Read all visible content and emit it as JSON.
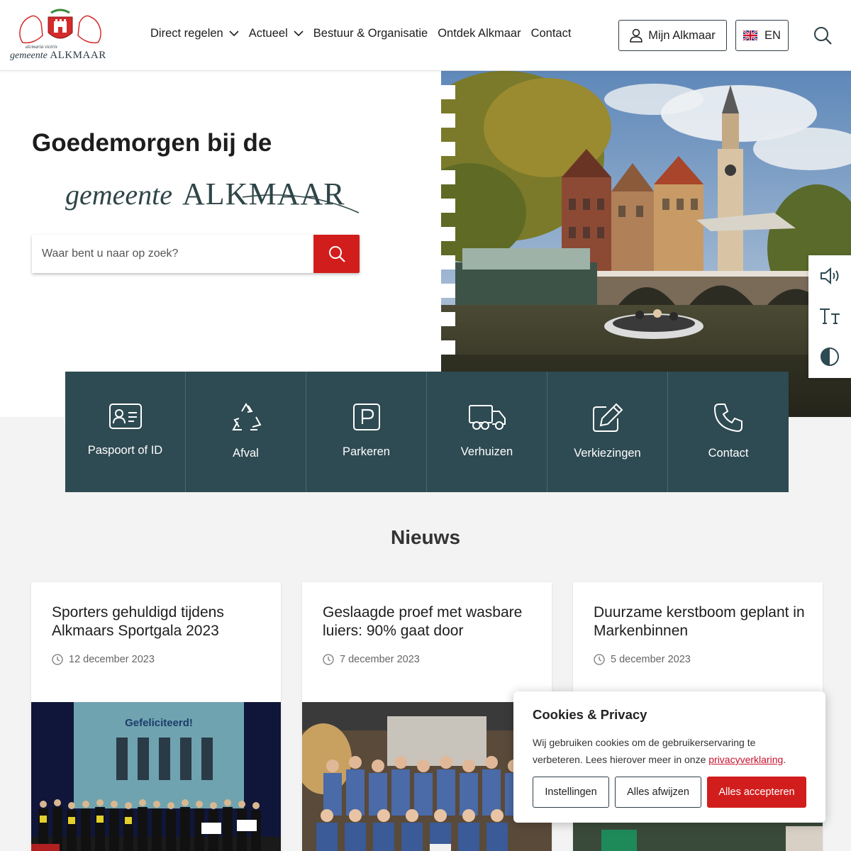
{
  "header": {
    "logo_motto": "alcmaria victrix",
    "logo_word_small": "gemeente",
    "logo_word_big": "ALKMAAR",
    "nav": [
      {
        "label": "Direct regelen",
        "dropdown": true
      },
      {
        "label": "Actueel",
        "dropdown": true
      },
      {
        "label": "Bestuur & Organisatie",
        "dropdown": false
      },
      {
        "label": "Ontdek Alkmaar",
        "dropdown": false
      },
      {
        "label": "Contact",
        "dropdown": false
      }
    ],
    "mijn_label": "Mijn Alkmaar",
    "lang_label": "EN",
    "icons": {
      "user": "user-icon",
      "flag": "uk-flag-icon",
      "search": "search-icon"
    }
  },
  "hero": {
    "greeting": "Goedemorgen bij de",
    "brand_small": "gemeente",
    "brand_big": "ALKMAAR",
    "search_placeholder": "Waar bent u naar op zoek?"
  },
  "accessibility": [
    {
      "icon": "speaker-icon"
    },
    {
      "icon": "text-size-icon"
    },
    {
      "icon": "contrast-icon"
    }
  ],
  "tiles": [
    {
      "label": "Paspoort of ID",
      "icon": "id-card-icon"
    },
    {
      "label": "Afval",
      "icon": "recycle-icon"
    },
    {
      "label": "Parkeren",
      "icon": "parking-icon"
    },
    {
      "label": "Verhuizen",
      "icon": "truck-icon"
    },
    {
      "label": "Verkiezingen",
      "icon": "pencil-icon"
    },
    {
      "label": "Contact",
      "icon": "phone-icon"
    }
  ],
  "news": {
    "title": "Nieuws",
    "items": [
      {
        "title": "Sporters gehuldigd tijdens Alkmaars Sportgala 2023",
        "date": "12 december 2023",
        "image_text": "Gefeliciteerd!"
      },
      {
        "title": "Geslaagde proef met wasbare luiers: 90% gaat door",
        "date": "7 december 2023"
      },
      {
        "title": "Duurzame kerstboom geplant in Markenbinnen",
        "date": "5 december 2023"
      }
    ]
  },
  "cookie": {
    "title": "Cookies & Privacy",
    "text_before": "Wij gebruiken cookies om de gebruikerservaring te verbeteren. Lees hierover meer in onze ",
    "link": "privacyverklaring",
    "text_after": ".",
    "settings": "Instellingen",
    "reject": "Alles afwijzen",
    "accept": "Alles accepteren"
  },
  "colors": {
    "accent_red": "#d21d1d",
    "tile_teal": "#2e4a52",
    "page_grey": "#f3f3f3"
  }
}
